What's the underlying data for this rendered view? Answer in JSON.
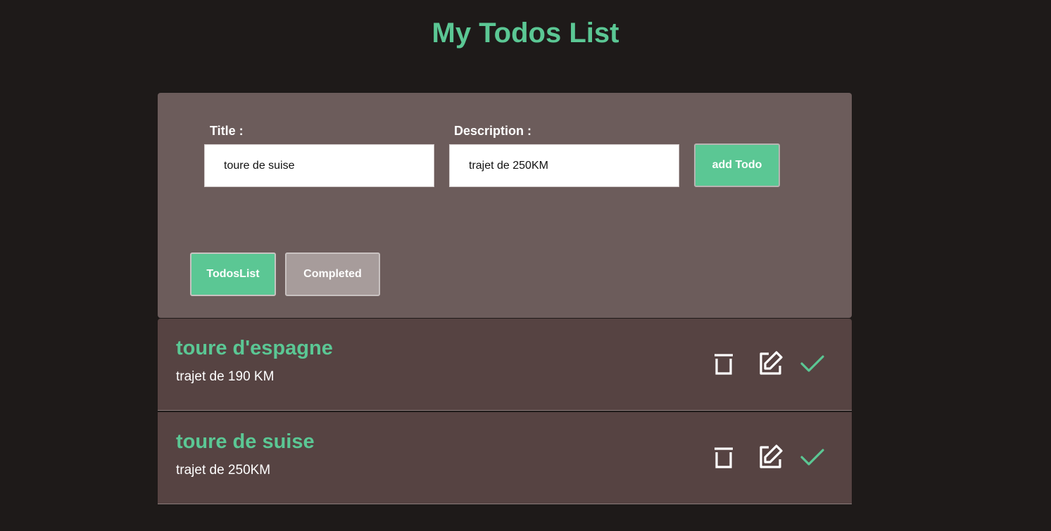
{
  "header": {
    "title": "My Todos List"
  },
  "form": {
    "title_label": "Title :",
    "title_value": "toure de suise",
    "description_label": "Description :",
    "description_value": "trajet de 250KM",
    "add_button_label": "add Todo"
  },
  "tabs": [
    {
      "label": "TodosList",
      "active": true
    },
    {
      "label": "Completed",
      "active": false
    }
  ],
  "todos": [
    {
      "title": "toure d'espagne",
      "description": "trajet de 190 KM"
    },
    {
      "title": "toure de suise",
      "description": "trajet de 250KM"
    }
  ],
  "icons": {
    "delete": "trash-icon",
    "edit": "edit-icon",
    "complete": "check-icon"
  },
  "colors": {
    "accent": "#5bc794",
    "background": "#1e1a19",
    "panel": "#6c5c5b",
    "item": "#564342",
    "inactive_tab": "#a79c9b"
  }
}
